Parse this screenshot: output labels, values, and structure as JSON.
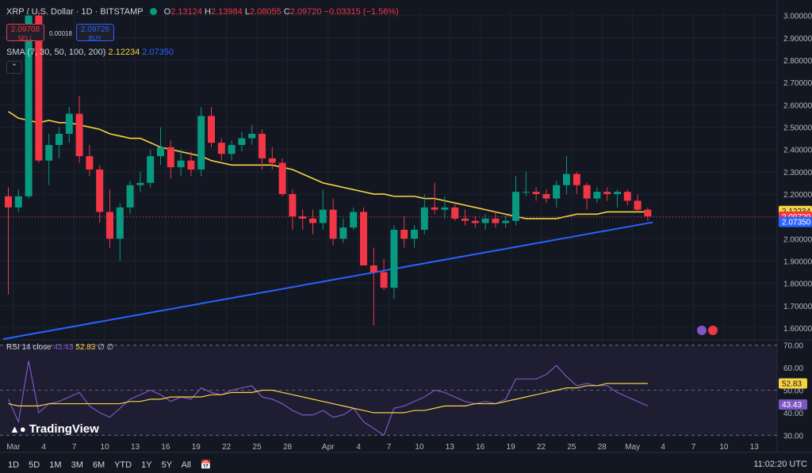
{
  "header": {
    "symbol": "XRP / U.S. Dollar · 1D · BITSTAMP",
    "o_label": "O",
    "o": "2.13124",
    "h_label": "H",
    "h": "2.13984",
    "l_label": "L",
    "l": "2.08055",
    "c_label": "C",
    "c": "2.09720",
    "change": "−0.03315 (−1.56%)"
  },
  "trade": {
    "sell_price": "2.09708",
    "sell_label": "SELL",
    "spread": "0.00018",
    "buy_price": "2.09726",
    "buy_label": "BUY"
  },
  "sma_legend": {
    "label": "SMA (7, 30, 50, 100, 200)",
    "v1": "2.12234",
    "v2": "2.07350"
  },
  "rsi_legend": {
    "label": "RSI 14 close",
    "v1": "43.43",
    "v2": "52.83",
    "v3": "∅ ∅"
  },
  "timeframes": [
    "1D",
    "5D",
    "1M",
    "3M",
    "6M",
    "YTD",
    "1Y",
    "5Y",
    "All"
  ],
  "clock": "11:02:20 UTC",
  "logo": "TradingView",
  "colors": {
    "up": "#089981",
    "down": "#f23645",
    "sma_fast": "#f5d442",
    "sma_slow": "#2962ff",
    "rsi": "#7e57c2",
    "rsi_ma": "#f5d442",
    "bg": "#131722"
  },
  "chart_data": [
    {
      "type": "candlestick",
      "title": "XRP / U.S. Dollar · 1D · BITSTAMP",
      "y_ticks": [
        "3.00000",
        "2.90000",
        "2.80000",
        "2.70000",
        "2.60000",
        "2.50000",
        "2.40000",
        "2.30000",
        "2.20000",
        "2.10000",
        "2.00000",
        "1.90000",
        "1.80000",
        "1.70000",
        "1.60000"
      ],
      "ylim": [
        1.55,
        3.02
      ],
      "x_ticks": [
        {
          "label": "Mar",
          "idx": 0.5
        },
        {
          "label": "4",
          "idx": 3.5
        },
        {
          "label": "7",
          "idx": 6.5
        },
        {
          "label": "10",
          "idx": 9.5
        },
        {
          "label": "13",
          "idx": 12.5
        },
        {
          "label": "16",
          "idx": 15.5
        },
        {
          "label": "19",
          "idx": 18.5
        },
        {
          "label": "22",
          "idx": 21.5
        },
        {
          "label": "25",
          "idx": 24.5
        },
        {
          "label": "28",
          "idx": 27.5
        },
        {
          "label": "Apr",
          "idx": 31.5
        },
        {
          "label": "4",
          "idx": 34.5
        },
        {
          "label": "7",
          "idx": 37.5
        },
        {
          "label": "10",
          "idx": 40.5
        },
        {
          "label": "13",
          "idx": 43.5
        },
        {
          "label": "16",
          "idx": 46.5
        },
        {
          "label": "19",
          "idx": 49.5
        },
        {
          "label": "22",
          "idx": 52.5
        },
        {
          "label": "25",
          "idx": 55.5
        },
        {
          "label": "28",
          "idx": 58.5
        },
        {
          "label": "May",
          "idx": 61.5
        },
        {
          "label": "4",
          "idx": 64.5
        },
        {
          "label": "7",
          "idx": 67.5
        },
        {
          "label": "10",
          "idx": 70.5
        },
        {
          "label": "13",
          "idx": 73.5
        }
      ],
      "candles": [
        [
          2.19,
          2.23,
          1.75,
          2.14
        ],
        [
          2.14,
          2.22,
          2.12,
          2.19
        ],
        [
          2.19,
          3.01,
          2.18,
          3.0
        ],
        [
          3.0,
          3.02,
          2.34,
          2.35
        ],
        [
          2.35,
          2.47,
          2.24,
          2.42
        ],
        [
          2.42,
          2.5,
          2.36,
          2.47
        ],
        [
          2.47,
          2.59,
          2.43,
          2.56
        ],
        [
          2.56,
          2.64,
          2.34,
          2.37
        ],
        [
          2.37,
          2.42,
          2.28,
          2.31
        ],
        [
          2.31,
          2.33,
          2.07,
          2.12
        ],
        [
          2.12,
          2.22,
          1.96,
          2.0
        ],
        [
          2.0,
          2.16,
          1.9,
          2.14
        ],
        [
          2.14,
          2.26,
          2.11,
          2.24
        ],
        [
          2.24,
          2.3,
          2.21,
          2.25
        ],
        [
          2.25,
          2.4,
          2.23,
          2.37
        ],
        [
          2.37,
          2.5,
          2.33,
          2.41
        ],
        [
          2.41,
          2.44,
          2.27,
          2.32
        ],
        [
          2.32,
          2.4,
          2.28,
          2.35
        ],
        [
          2.35,
          2.39,
          2.28,
          2.31
        ],
        [
          2.31,
          2.59,
          2.28,
          2.55
        ],
        [
          2.55,
          2.59,
          2.41,
          2.43
        ],
        [
          2.43,
          2.45,
          2.35,
          2.38
        ],
        [
          2.38,
          2.44,
          2.35,
          2.42
        ],
        [
          2.42,
          2.48,
          2.39,
          2.45
        ],
        [
          2.45,
          2.51,
          2.42,
          2.47
        ],
        [
          2.47,
          2.49,
          2.31,
          2.36
        ],
        [
          2.36,
          2.41,
          2.31,
          2.34
        ],
        [
          2.34,
          2.36,
          2.19,
          2.2
        ],
        [
          2.2,
          2.22,
          2.04,
          2.1
        ],
        [
          2.1,
          2.13,
          2.04,
          2.09
        ],
        [
          2.09,
          2.13,
          2.02,
          2.07
        ],
        [
          2.07,
          2.22,
          2.04,
          2.13
        ],
        [
          2.13,
          2.18,
          1.97,
          2.0
        ],
        [
          2.0,
          2.09,
          1.98,
          2.05
        ],
        [
          2.05,
          2.14,
          2.04,
          2.12
        ],
        [
          2.12,
          2.14,
          1.9,
          1.88
        ],
        [
          1.88,
          1.96,
          1.61,
          1.85
        ],
        [
          1.85,
          1.91,
          1.77,
          1.78
        ],
        [
          1.78,
          2.06,
          1.73,
          2.04
        ],
        [
          2.04,
          2.1,
          1.96,
          2.0
        ],
        [
          2.0,
          2.06,
          1.96,
          2.04
        ],
        [
          2.04,
          2.2,
          2.02,
          2.14
        ],
        [
          2.14,
          2.25,
          2.11,
          2.13
        ],
        [
          2.13,
          2.19,
          2.09,
          2.14
        ],
        [
          2.14,
          2.16,
          2.08,
          2.09
        ],
        [
          2.09,
          2.13,
          2.06,
          2.08
        ],
        [
          2.08,
          2.1,
          2.05,
          2.07
        ],
        [
          2.07,
          2.11,
          2.04,
          2.09
        ],
        [
          2.09,
          2.12,
          2.05,
          2.07
        ],
        [
          2.07,
          2.11,
          2.05,
          2.08
        ],
        [
          2.08,
          2.28,
          2.06,
          2.21
        ],
        [
          2.21,
          2.3,
          2.19,
          2.21
        ],
        [
          2.21,
          2.23,
          2.17,
          2.2
        ],
        [
          2.2,
          2.22,
          2.16,
          2.18
        ],
        [
          2.18,
          2.26,
          2.14,
          2.24
        ],
        [
          2.24,
          2.37,
          2.2,
          2.29
        ],
        [
          2.29,
          2.3,
          2.2,
          2.24
        ],
        [
          2.24,
          2.25,
          2.13,
          2.18
        ],
        [
          2.18,
          2.23,
          2.16,
          2.21
        ],
        [
          2.21,
          2.23,
          2.17,
          2.2
        ],
        [
          2.2,
          2.22,
          2.14,
          2.21
        ],
        [
          2.21,
          2.22,
          2.15,
          2.17
        ],
        [
          2.17,
          2.2,
          2.12,
          2.13
        ],
        [
          2.13,
          2.14,
          2.08,
          2.1
        ]
      ],
      "series": [
        {
          "name": "SMA 50",
          "color": "#f5d442",
          "values": [
            2.57,
            2.54,
            2.53,
            2.52,
            2.53,
            2.52,
            2.52,
            2.51,
            2.5,
            2.49,
            2.47,
            2.46,
            2.45,
            2.45,
            2.43,
            2.41,
            2.4,
            2.39,
            2.38,
            2.37,
            2.35,
            2.34,
            2.33,
            2.33,
            2.33,
            2.33,
            2.33,
            2.32,
            2.31,
            2.29,
            2.27,
            2.25,
            2.24,
            2.23,
            2.22,
            2.21,
            2.2,
            2.2,
            2.19,
            2.19,
            2.19,
            2.18,
            2.18,
            2.17,
            2.16,
            2.15,
            2.14,
            2.13,
            2.12,
            2.11,
            2.1,
            2.09,
            2.09,
            2.09,
            2.09,
            2.1,
            2.11,
            2.11,
            2.11,
            2.12,
            2.12,
            2.12,
            2.12,
            2.12
          ]
        },
        {
          "name": "SMA 200",
          "color": "#2962ff",
          "start": [
            -0.5,
            1.55
          ],
          "end": [
            63.5,
            2.0735
          ]
        }
      ],
      "price_labels": [
        {
          "text": "2.12234",
          "value": 2.12234,
          "color": "#f5d442",
          "fg": "#131722"
        },
        {
          "text": "2.09720",
          "value": 2.0972,
          "color": "#f23645",
          "fg": "#ffffff"
        },
        {
          "text": "2.07350",
          "value": 2.0735,
          "color": "#2962ff",
          "fg": "#ffffff"
        }
      ]
    },
    {
      "type": "line",
      "title": "RSI 14 close",
      "y_ticks": [
        "70.00",
        "60.00",
        "50.00",
        "40.00",
        "30.00"
      ],
      "ylim": [
        28,
        72
      ],
      "bands": {
        "upper": 70,
        "lower": 30,
        "middle": 50
      },
      "series": [
        {
          "name": "RSI",
          "color": "#7e57c2",
          "values": [
            46,
            36,
            63,
            40,
            44,
            45,
            47,
            49,
            43,
            40,
            38,
            42,
            46,
            48,
            50,
            48,
            45,
            47,
            46,
            51,
            49,
            48,
            50,
            51,
            52,
            47,
            46,
            44,
            41,
            39,
            39,
            41,
            38,
            39,
            42,
            36,
            33,
            30,
            42,
            43,
            45,
            47,
            50,
            49,
            47,
            45,
            44,
            45,
            44,
            46,
            55,
            55,
            55,
            57,
            61,
            56,
            52,
            53,
            52,
            52,
            49,
            47,
            45,
            43
          ]
        },
        {
          "name": "RSI MA",
          "color": "#f5d442",
          "values": [
            44,
            43,
            43,
            43,
            44,
            44,
            44,
            44,
            44,
            44,
            44,
            44,
            45,
            45,
            46,
            46,
            47,
            47,
            47,
            47,
            48,
            48,
            49,
            49,
            49,
            50,
            50,
            49,
            48,
            47,
            46,
            45,
            44,
            43,
            42,
            41,
            40,
            40,
            40,
            40,
            41,
            41,
            42,
            43,
            43,
            43,
            44,
            44,
            44,
            45,
            46,
            47,
            48,
            49,
            50,
            51,
            51,
            52,
            52,
            53,
            53,
            53,
            53,
            53
          ]
        }
      ],
      "price_labels": [
        {
          "text": "52.83",
          "value": 52.83,
          "color": "#f5d442",
          "fg": "#131722"
        },
        {
          "text": "43.43",
          "value": 43.43,
          "color": "#7e57c2",
          "fg": "#ffffff"
        }
      ]
    }
  ]
}
